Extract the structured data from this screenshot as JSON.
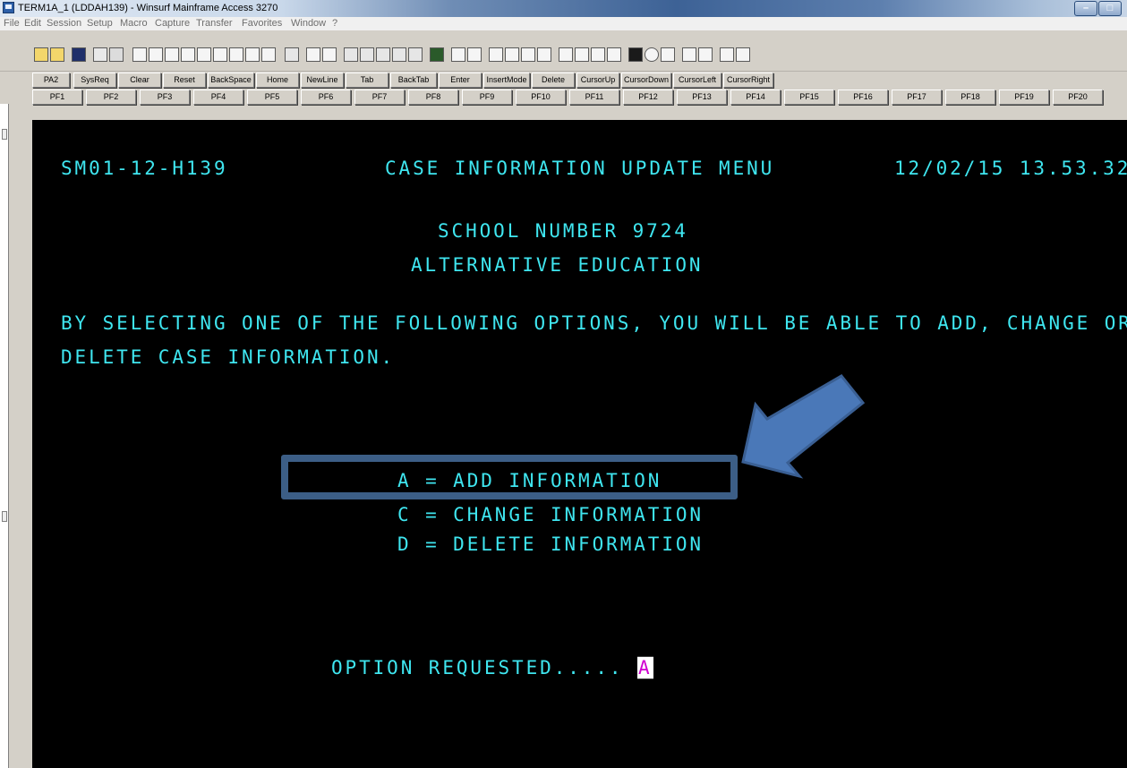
{
  "window": {
    "title": "TERM1A_1 (LDDAH139) - Winsurf Mainframe Access 3270"
  },
  "menu": [
    "File",
    "Edit",
    "Session",
    "Setup",
    "Macro",
    "Capture",
    "Transfer",
    "Favorites",
    "Window",
    "?"
  ],
  "keys_row1": [
    "PA2",
    "SysReq",
    "Clear",
    "Reset",
    "BackSpace",
    "Home",
    "NewLine",
    "Tab",
    "BackTab",
    "Enter",
    "InsertMode",
    "Delete",
    "CursorUp",
    "CursorDown",
    "CursorLeft",
    "CursorRight"
  ],
  "keys_row2": [
    "PF1",
    "PF2",
    "PF3",
    "PF4",
    "PF5",
    "PF6",
    "PF7",
    "PF8",
    "PF9",
    "PF10",
    "PF11",
    "PF12",
    "PF13",
    "PF14",
    "PF15",
    "PF16",
    "PF17",
    "PF18",
    "PF19",
    "PF20"
  ],
  "terminal": {
    "screen_id": "SM01-12-H139",
    "heading": "CASE INFORMATION UPDATE MENU",
    "datetime": "12/02/15 13.53.32",
    "school": "SCHOOL NUMBER 9724",
    "program": "ALTERNATIVE EDUCATION",
    "instructions_line1": "BY SELECTING ONE OF THE FOLLOWING OPTIONS, YOU WILL BE ABLE TO ADD, CHANGE OR",
    "instructions_line2": "DELETE CASE INFORMATION.",
    "options": [
      {
        "label": "A = ADD INFORMATION"
      },
      {
        "label": "C = CHANGE INFORMATION"
      },
      {
        "label": "D = DELETE INFORMATION"
      }
    ],
    "prompt": "OPTION REQUESTED.....",
    "input_value": "A"
  },
  "annotation": {
    "highlighted_option": "A = ADD INFORMATION",
    "box_color": "#3c5e86",
    "arrow_color": "#4a78b8"
  },
  "colors": {
    "terminal_text": "#3fe6f0",
    "terminal_bg": "#000000",
    "cursor_text": "#d000d0"
  }
}
